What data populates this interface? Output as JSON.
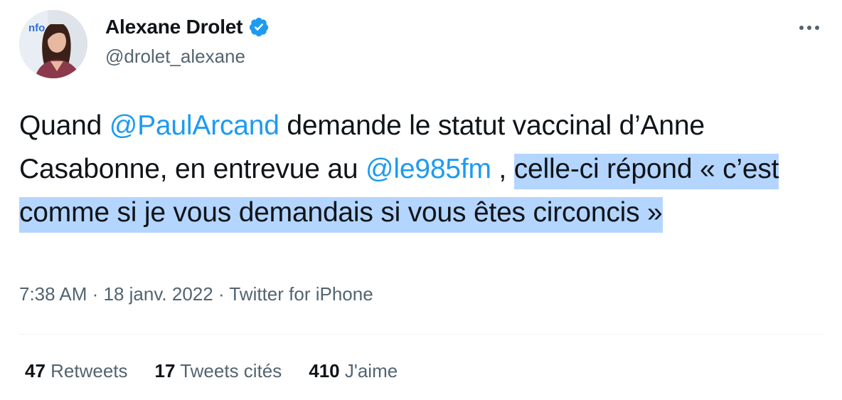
{
  "author": {
    "name": "Alexane Drolet",
    "handle": "@drolet_alexane",
    "avatar_logo_text": "nfo"
  },
  "tweet": {
    "text_part1": "Quand ",
    "mention1": "@PaulArcand",
    "text_part2": " demande le statut vaccinal d’Anne Casabonne, en entrevue au ",
    "mention2": "@le985fm",
    "text_part3": " , ",
    "selected_text": "celle-ci répond « c’est comme si je vous demandais si vous êtes circoncis »"
  },
  "meta": {
    "time": "7:38 AM",
    "separator1": " · ",
    "date": "18 janv. 2022",
    "separator2": " · ",
    "source": "Twitter for iPhone"
  },
  "stats": {
    "retweets_count": "47",
    "retweets_label": " Retweets",
    "quotes_count": "17",
    "quotes_label": " Tweets cités",
    "likes_count": "410",
    "likes_label": " J'aime"
  },
  "colors": {
    "link": "#1d9bf0",
    "verified": "#1d9bf0",
    "secondary_text": "#536471",
    "selection": "#b4d5fe"
  },
  "icons": {
    "verified": "verified-badge-icon",
    "more": "more-horizontal-icon"
  }
}
